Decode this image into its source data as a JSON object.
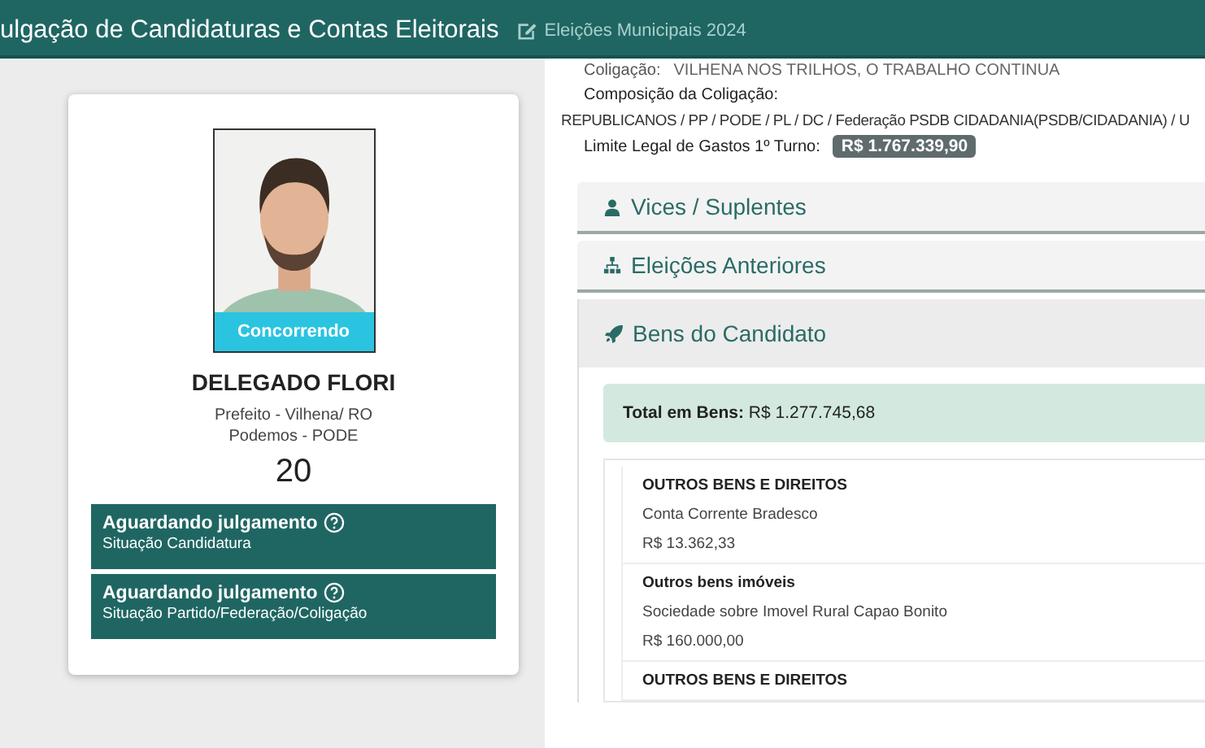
{
  "header": {
    "title": "ulgação de Candidaturas e Contas Eleitorais",
    "link": "Eleições Municipais 2024"
  },
  "candidate": {
    "status_badge": "Concorrendo",
    "name": "DELEGADO FLORI",
    "office": "Prefeito - Vilhena/ RO",
    "party": "Podemos - PODE",
    "number": "20",
    "situations": [
      {
        "status": "Aguardando julgamento",
        "label": "Situação Candidatura"
      },
      {
        "status": "Aguardando julgamento",
        "label": "Situação Partido/Federação/Coligação"
      }
    ]
  },
  "coalition": {
    "label": "Coligação:",
    "value": "VILHENA NOS TRILHOS, O TRABALHO CONTINUA",
    "composition_label": "Composição da Coligação:",
    "composition": "REPUBLICANOS / PP / PODE / PL / DC / Federação PSDB CIDADANIA(PSDB/CIDADANIA) / U",
    "spending_limit_label": "Limite Legal de Gastos 1º Turno:",
    "spending_limit": "R$ 1.767.339,90"
  },
  "sections": [
    {
      "title": "Vices / Suplentes",
      "expanded": false
    },
    {
      "title": "Eleições Anteriores",
      "expanded": false
    },
    {
      "title": "Bens do Candidato",
      "expanded": true
    }
  ],
  "assets": {
    "total_label": "Total em Bens:",
    "total": "R$ 1.277.745,68",
    "items": [
      {
        "type": "OUTROS BENS E DIREITOS",
        "description": "Conta Corrente Bradesco",
        "value": "R$ 13.362,33"
      },
      {
        "type": "Outros bens imóveis",
        "description": "Sociedade sobre Imovel Rural Capao Bonito",
        "value": "R$ 160.000,00"
      },
      {
        "type": "OUTROS BENS E DIREITOS"
      }
    ]
  }
}
